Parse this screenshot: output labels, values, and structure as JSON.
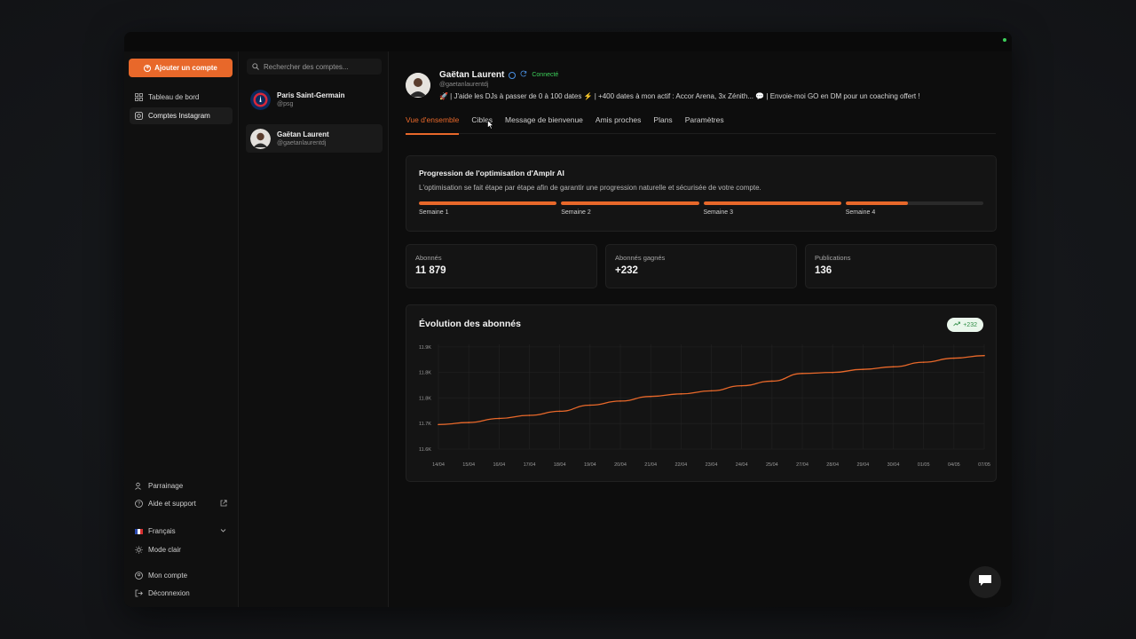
{
  "sidebar": {
    "add_button": "Ajouter un compte",
    "nav": [
      {
        "label": "Tableau de bord",
        "icon": "dashboard-icon"
      },
      {
        "label": "Comptes Instagram",
        "icon": "instagram-icon"
      }
    ],
    "bottom": [
      {
        "label": "Parrainage",
        "icon": "users-icon"
      },
      {
        "label": "Aide et support",
        "icon": "help-icon"
      },
      {
        "label": "Français",
        "icon": "flag-fr-icon"
      },
      {
        "label": "Mode clair",
        "icon": "sun-icon"
      },
      {
        "label": "Mon compte",
        "icon": "user-icon"
      },
      {
        "label": "Déconnexion",
        "icon": "logout-icon"
      }
    ]
  },
  "accounts": {
    "search_placeholder": "Rechercher des comptes...",
    "items": [
      {
        "name": "Paris Saint-Germain",
        "handle": "@psg"
      },
      {
        "name": "Gaëtan Laurent",
        "handle": "@gaetanlaurentdj"
      }
    ]
  },
  "profile": {
    "name": "Gaëtan Laurent",
    "status": "Connecté",
    "handle": "@gaetanlaurentdj",
    "bio": "🚀 | J'aide les DJs à passer de 0 à 100 dates ⚡ | +400 dates à mon actif : Accor Arena, 3x Zénith... 💬 | Envoie-moi GO en DM pour un coaching offert !"
  },
  "tabs": [
    "Vue d'ensemble",
    "Cibles",
    "Message de bienvenue",
    "Amis proches",
    "Plans",
    "Paramètres"
  ],
  "progress": {
    "title": "Progression de l'optimisation d'Amplr AI",
    "description": "L'optimisation se fait étape par étape afin de garantir une progression naturelle et sécurisée de votre compte.",
    "weeks": [
      {
        "label": "Semaine 1",
        "fill": 1.0
      },
      {
        "label": "Semaine 2",
        "fill": 1.0
      },
      {
        "label": "Semaine 3",
        "fill": 1.0
      },
      {
        "label": "Semaine 4",
        "fill": 0.45
      }
    ]
  },
  "stats": [
    {
      "label": "Abonnés",
      "value": "11 879"
    },
    {
      "label": "Abonnés gagnés",
      "value": "+232"
    },
    {
      "label": "Publications",
      "value": "136"
    }
  ],
  "chart_card": {
    "title": "Évolution des abonnés",
    "badge": "+232"
  },
  "chart_data": {
    "type": "line",
    "title": "Évolution des abonnés",
    "ytick_labels": [
      "11.9K",
      "11.8K",
      "11.8K",
      "11.7K",
      "11.6K"
    ],
    "ytick_values": [
      11900,
      11850,
      11800,
      11750,
      11700
    ],
    "ylim": [
      11700,
      11905
    ],
    "x": [
      "14/04",
      "15/04",
      "16/04",
      "17/04",
      "18/04",
      "19/04",
      "20/04",
      "21/04",
      "22/04",
      "23/04",
      "24/04",
      "25/04",
      "27/04",
      "28/04",
      "29/04",
      "30/04",
      "01/05",
      "04/05",
      "07/05"
    ],
    "series": [
      {
        "values": [
          11748,
          11752,
          11760,
          11766,
          11774,
          11786,
          11794,
          11803,
          11808,
          11814,
          11824,
          11833,
          11848,
          11850,
          11856,
          11861,
          11870,
          11878,
          11883
        ]
      }
    ],
    "grid": true,
    "color": "#e8682a"
  },
  "colors": {
    "accent": "#e8682a",
    "connected": "#3ccf5a"
  }
}
